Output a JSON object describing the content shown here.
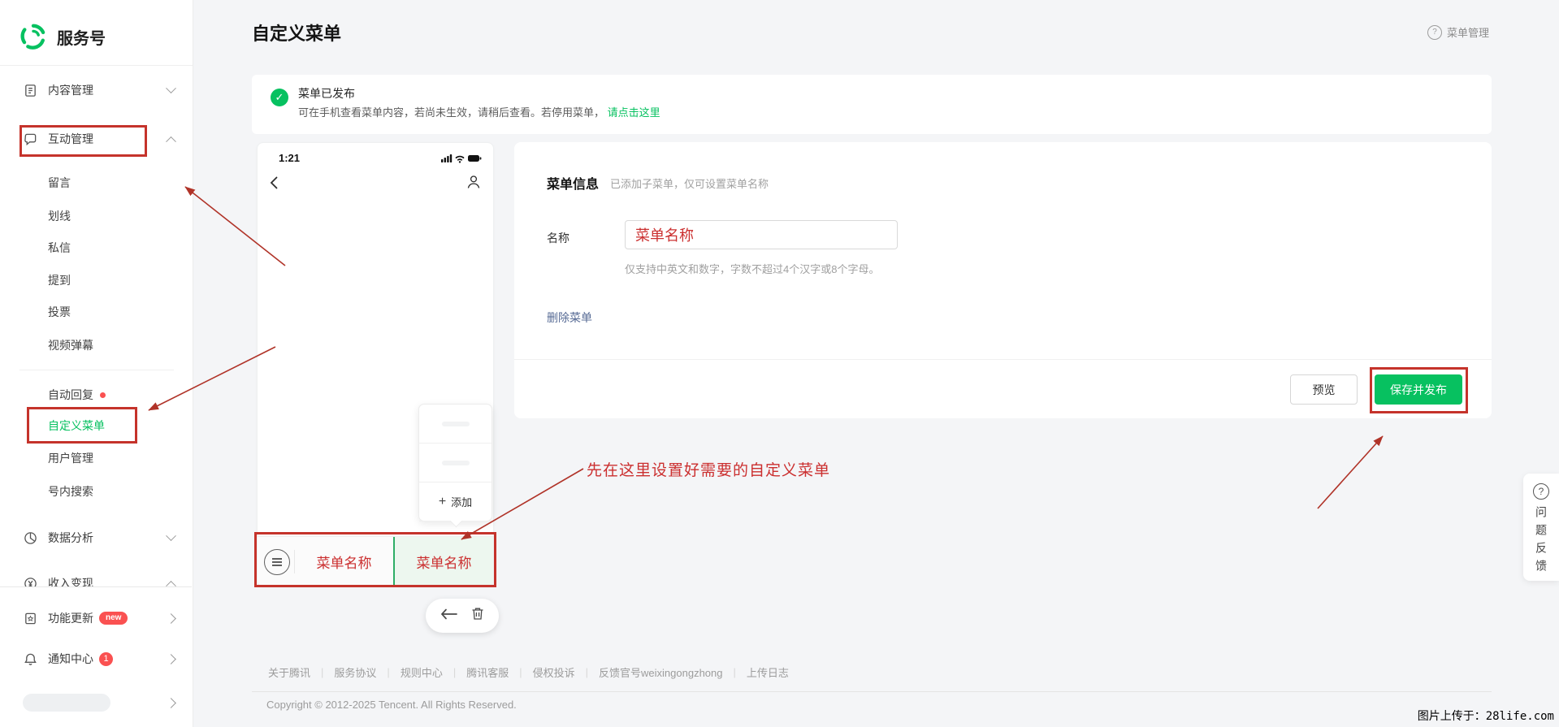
{
  "sidebar": {
    "brand": "服务号",
    "content_mgmt": "内容管理",
    "interact_mgmt": "互动管理",
    "sub_items": [
      "留言",
      "划线",
      "私信",
      "提到",
      "投票",
      "视频弹幕"
    ],
    "auto_reply": "自动回复",
    "custom_menu": "自定义菜单",
    "user_mgmt": "用户管理",
    "account_search": "号内搜索",
    "data_analysis": "数据分析",
    "monetization": "收入变现",
    "feature_update": "功能更新",
    "feature_update_badge": "new",
    "notification_center": "通知中心",
    "notification_badge": "1"
  },
  "header": {
    "title": "自定义菜单",
    "help": "菜单管理"
  },
  "banner": {
    "title": "菜单已发布",
    "desc": "可在手机查看菜单内容，若尚未生效，请稍后查看。若停用菜单，",
    "link": "请点击这里"
  },
  "phone": {
    "time": "1:21",
    "popup_plus": "+",
    "popup_add": "添加",
    "menu_item_1": "菜单名称",
    "menu_item_2": "菜单名称"
  },
  "form": {
    "section_title": "菜单信息",
    "section_hint": "已添加子菜单，仅可设置菜单名称",
    "name_label": "名称",
    "name_value": "菜单名称",
    "name_help": "仅支持中英文和数字，字数不超过4个汉字或8个字母。",
    "delete_link": "删除菜单",
    "preview_button": "预览",
    "save_button": "保存并发布"
  },
  "annotations": {
    "tip": "先在这里设置好需要的自定义菜单"
  },
  "footer": {
    "links": [
      "关于腾讯",
      "服务协议",
      "规则中心",
      "腾讯客服",
      "侵权投诉",
      "反馈官号weixingongzhong",
      "上传日志"
    ],
    "sep": "|",
    "copyright": "Copyright © 2012-2025 Tencent. All Rights Reserved."
  },
  "feedback": {
    "label": "问题反馈"
  },
  "watermark": "图片上传于：28life.com",
  "colors": {
    "brand": "#07c160",
    "annotation_red": "#c5332b",
    "badge_red": "#fa5151"
  }
}
